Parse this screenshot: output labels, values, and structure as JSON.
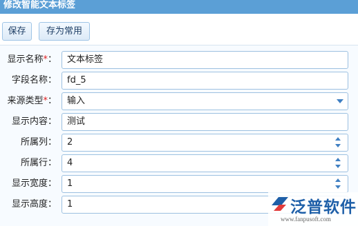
{
  "window": {
    "title": "修改智能文本标签"
  },
  "toolbar": {
    "save_label": "保存",
    "save_as_common_label": "存为常用"
  },
  "form": {
    "required_mark": "*",
    "fields": [
      {
        "label": "显示名称",
        "required": true,
        "value": "文本标签",
        "kind": "text"
      },
      {
        "label": "字段名称",
        "required": false,
        "value": "fd_5",
        "kind": "text"
      },
      {
        "label": "来源类型",
        "required": true,
        "value": "输入",
        "kind": "select"
      },
      {
        "label": "显示内容",
        "required": false,
        "value": "测试",
        "kind": "text"
      },
      {
        "label": "所属列",
        "required": false,
        "value": "2",
        "kind": "number"
      },
      {
        "label": "所属行",
        "required": false,
        "value": "4",
        "kind": "number"
      },
      {
        "label": "显示宽度",
        "required": false,
        "value": "1",
        "kind": "number"
      },
      {
        "label": "显示高度",
        "required": false,
        "value": "1",
        "kind": "number"
      }
    ],
    "colon": "："
  },
  "watermark": {
    "brand": "泛普软件",
    "url": "www.fanpusoft.com"
  },
  "colors": {
    "titlebar": "#5b9fd6",
    "accent": "#3f7fc2",
    "required": "#e02020"
  }
}
